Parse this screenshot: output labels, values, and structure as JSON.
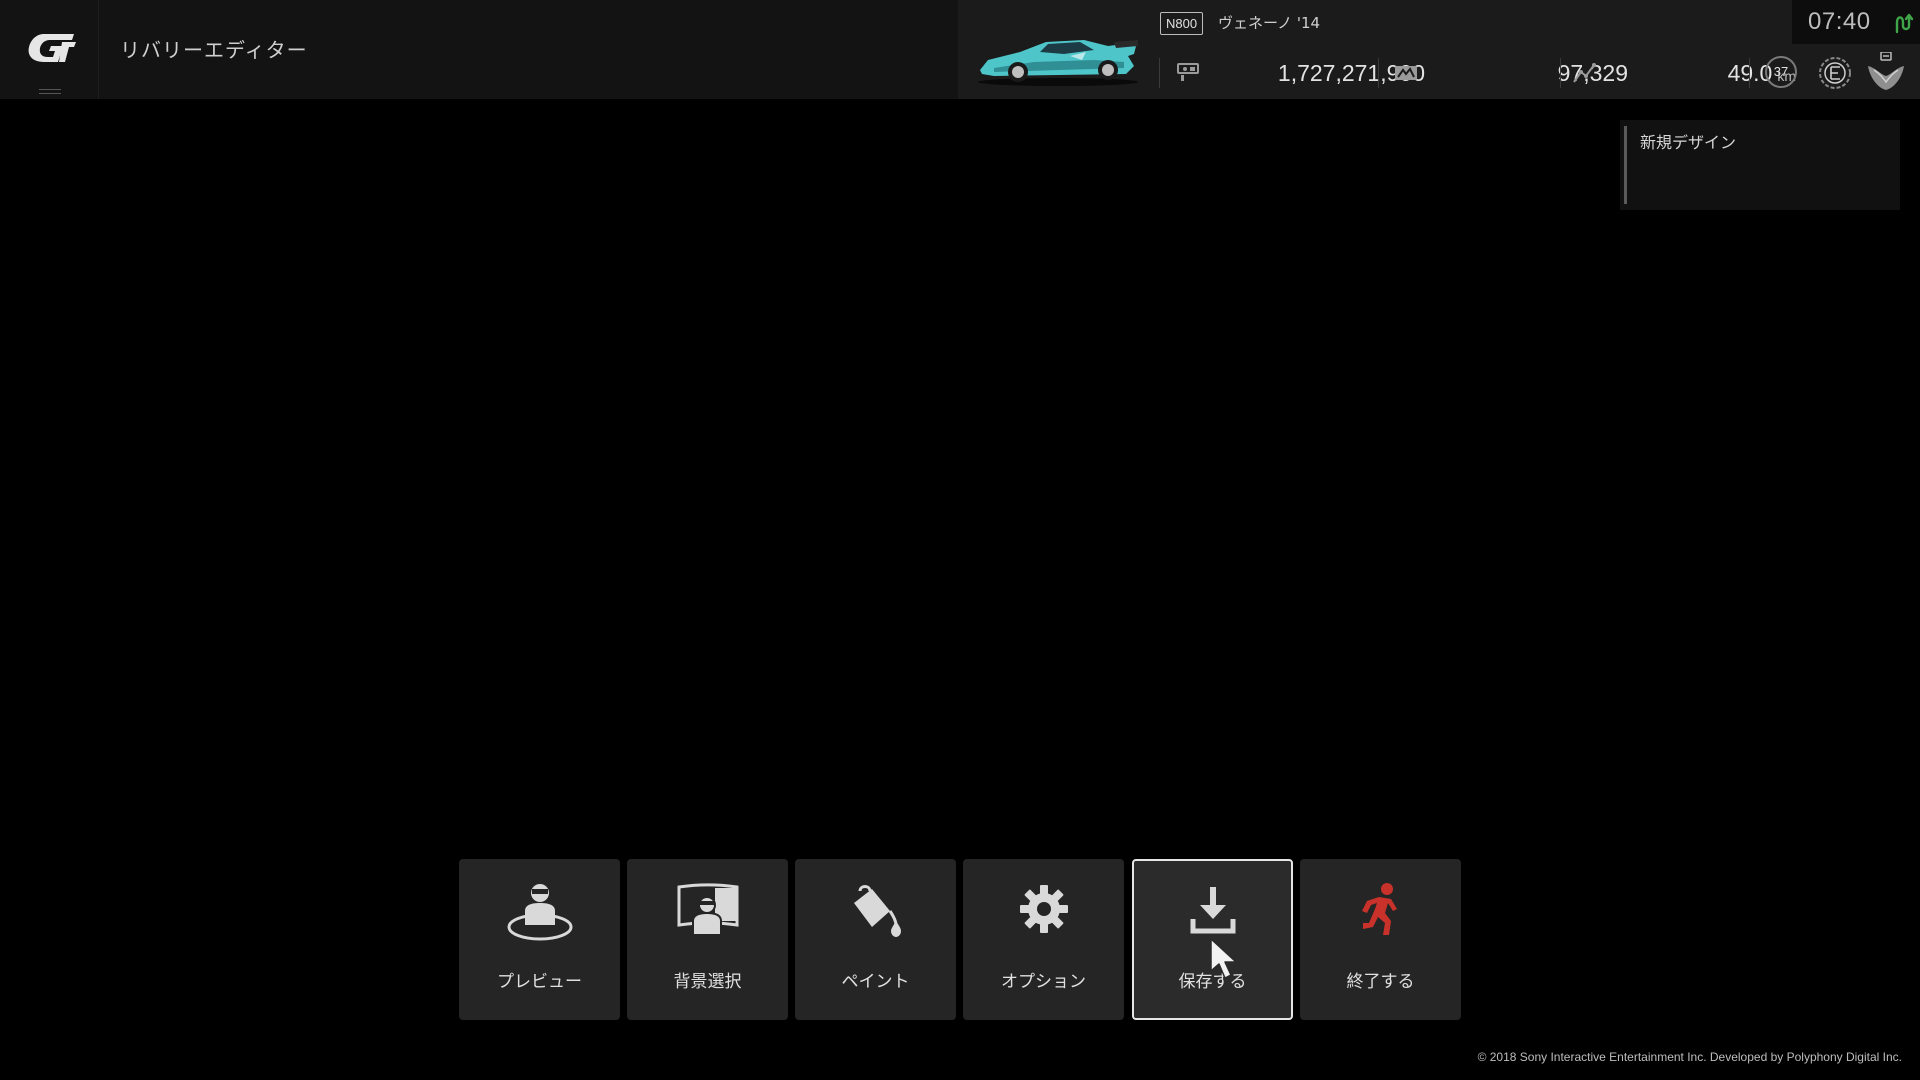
{
  "header": {
    "title": "リバリーエディター",
    "logo_icon": "gt-logo-icon"
  },
  "car": {
    "class": "N800",
    "name": "ヴェネーノ '14",
    "body_color": "#4ec6c9"
  },
  "stats": {
    "credits": "1,727,271,900",
    "mileage_points": "97,329",
    "distance": "49.0",
    "distance_unit": "km",
    "level": "37",
    "rank_icon": "driver-rank-e-icon",
    "emblem_icon": "manufacturer-emblem-icon"
  },
  "clock": {
    "time": "07:40",
    "status_color": "#3ea548"
  },
  "design": {
    "name": "新規デザイン"
  },
  "menu": {
    "items": [
      {
        "label": "プレビュー",
        "icon": "preview-icon"
      },
      {
        "label": "背景選択",
        "icon": "background-select-icon"
      },
      {
        "label": "ペイント",
        "icon": "paint-bucket-icon"
      },
      {
        "label": "オプション",
        "icon": "gear-icon"
      },
      {
        "label": "保存する",
        "icon": "save-download-icon",
        "selected": true
      },
      {
        "label": "終了する",
        "icon": "exit-running-icon",
        "color": "#c8322a"
      }
    ]
  },
  "footer": {
    "copyright": "© 2018 Sony Interactive Entertainment Inc. Developed by Polyphony Digital Inc."
  }
}
